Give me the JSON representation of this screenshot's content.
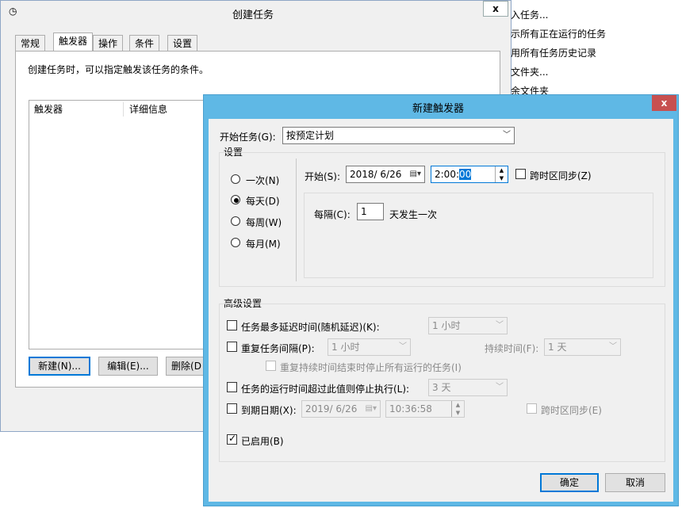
{
  "create_task": {
    "title": "创建任务",
    "close_label": "x",
    "tabs": [
      "常规",
      "触发器",
      "操作",
      "条件",
      "设置"
    ],
    "description": "创建任务时，可以指定触发该任务的条件。",
    "columns": [
      "触发器",
      "详细信息"
    ],
    "buttons": {
      "new": "新建(N)...",
      "edit": "编辑(E)...",
      "delete": "删除(D"
    }
  },
  "background_menu": [
    "入任务...",
    "示所有正在运行的任务",
    "用所有任务历史记录",
    "文件夹...",
    "余文件夹"
  ],
  "dialog": {
    "title": "新建触发器",
    "close_label": "x",
    "start_task_label": "开始任务(G):",
    "start_task_value": "按预定计划",
    "settings_label": "设置",
    "schedule_options": [
      "一次(N)",
      "每天(D)",
      "每周(W)",
      "每月(M)"
    ],
    "selected_option": "每天(D)",
    "start_label": "开始(S):",
    "start_date": "2018/ 6/26",
    "start_time_prefix": "2:00:",
    "start_time_selected": "00",
    "sync_tz_label": "跨时区同步(Z)",
    "interval_label": "每隔(C):",
    "interval_value": "1",
    "interval_suffix": "天发生一次",
    "advanced_label": "高级设置",
    "delay_label": "任务最多延迟时间(随机延迟)(K):",
    "delay_value": "1 小时",
    "repeat_label": "重复任务间隔(P):",
    "repeat_value": "1 小时",
    "duration_label": "持续时间(F):",
    "duration_value": "1 天",
    "stop_at_end_label": "重复持续时间结束时停止所有运行的任务(I)",
    "stop_if_runs_label": "任务的运行时间超过此值则停止执行(L):",
    "stop_if_runs_value": "3 天",
    "expire_label": "到期日期(X):",
    "expire_date": "2019/ 6/26",
    "expire_time": "10:36:58",
    "expire_sync_label": "跨时区同步(E)",
    "enabled_label": "已启用(B)",
    "ok_label": "确定",
    "cancel_label": "取消"
  }
}
